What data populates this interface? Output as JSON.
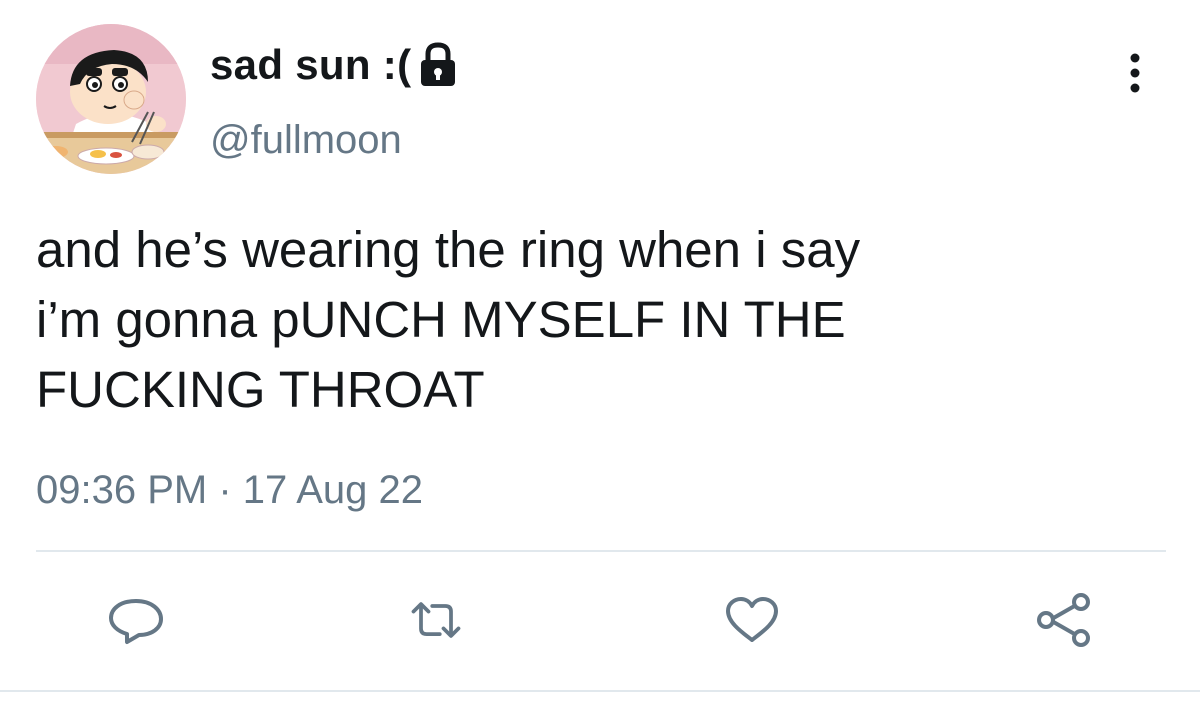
{
  "user": {
    "display_name": "sad sun :(",
    "handle": "@fullmoon",
    "avatar_icon": "cartoon-avatar",
    "protected_icon": "lock-icon"
  },
  "tweet": {
    "lines": [
      "and he’s wearing the ring when i say",
      "i’m gonna pUNCH MYSELF IN THE",
      "FUCKING THROAT"
    ],
    "time": "09:36 PM",
    "separator": "·",
    "date": "17 Aug 22"
  },
  "actions": [
    {
      "icon": "reply-icon"
    },
    {
      "icon": "retweet-icon"
    },
    {
      "icon": "like-icon"
    },
    {
      "icon": "share-icon"
    }
  ],
  "menu_icon": "more-icon",
  "colors": {
    "text": "#14171a",
    "secondary": "#657786",
    "divider": "#e1e8ed",
    "action_icon": "#657786"
  }
}
